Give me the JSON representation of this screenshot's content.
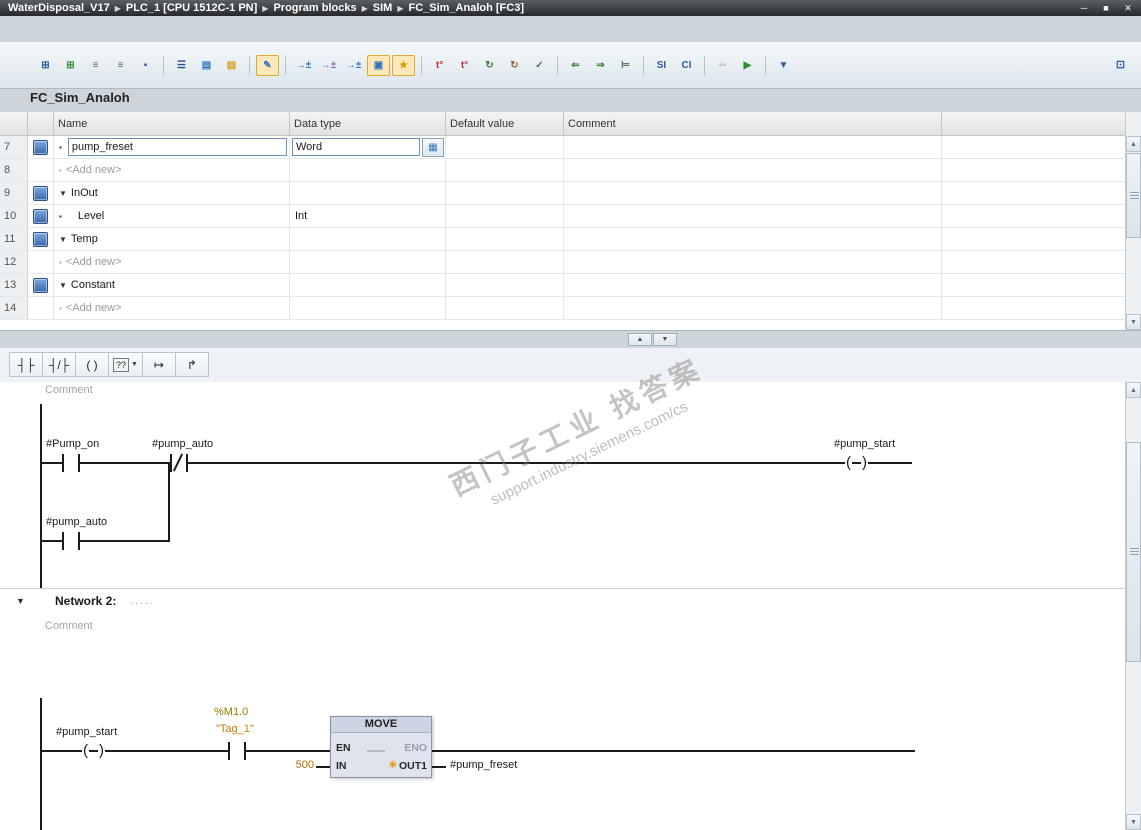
{
  "titlebar": {
    "breadcrumb": [
      "WaterDisposal_V17",
      "PLC_1 [CPU 1512C-1 PN]",
      "Program blocks",
      "SIM",
      "FC_Sim_Analoh [FC3]"
    ],
    "window_buttons": [
      {
        "name": "minimize-button",
        "glyph": "─"
      },
      {
        "name": "maximize-button",
        "glyph": "■"
      },
      {
        "name": "close-button",
        "glyph": "✕"
      }
    ]
  },
  "toolbar": {
    "icons": [
      {
        "name": "insert-row-icon",
        "glyph": "⊞",
        "color": "#2b5f9e"
      },
      {
        "name": "add-row-icon",
        "glyph": "⊞",
        "color": "#3a8a3a"
      },
      {
        "name": "reset-start-values-icon",
        "glyph": "≡",
        "color": "#5a6670"
      },
      {
        "name": "update-interface-icon",
        "glyph": "≡",
        "color": "#5a6670"
      },
      {
        "name": "keep-actual-values-icon",
        "glyph": "▪",
        "color": "#2b5f9e"
      },
      {
        "sep": true
      },
      {
        "name": "absolute-symbolic-operands-icon",
        "glyph": "☰",
        "color": "#1f4f8f"
      },
      {
        "name": "expand-all-networks-icon",
        "glyph": "▤",
        "color": "#2f74c0"
      },
      {
        "name": "collapse-all-networks-icon",
        "glyph": "▤",
        "color": "#d7a11e"
      },
      {
        "sep": true
      },
      {
        "name": "network-comments-icon",
        "glyph": "✎",
        "color": "#2f74c0",
        "active": true
      },
      {
        "sep": true
      },
      {
        "name": "insert-network-icon",
        "glyph": "→±",
        "color": "#2f74c0"
      },
      {
        "name": "insert-empty-box-icon",
        "glyph": "→±",
        "color": "#8a6ab8"
      },
      {
        "name": "open-all-branches-icon",
        "glyph": "→±",
        "color": "#2f74c0"
      },
      {
        "name": "lad-layout-toggle-icon",
        "glyph": "▣",
        "color": "#2f74c0",
        "active": true
      },
      {
        "name": "favorites-toggle-icon",
        "glyph": "★",
        "color": "#d79b00",
        "active": true
      },
      {
        "sep": true
      },
      {
        "name": "delete-timestamps-icon",
        "glyph": "t°",
        "color": "#c03030"
      },
      {
        "name": "update-block-calls-icon",
        "glyph": "t°",
        "color": "#c03030"
      },
      {
        "name": "sync-interface-icon",
        "glyph": "↻",
        "color": "#3a7a3a"
      },
      {
        "name": "consistency-check-icon",
        "glyph": "↻",
        "color": "#8a6a2a"
      },
      {
        "name": "compile-block-icon",
        "glyph": "✓",
        "color": "#3a7a3a"
      },
      {
        "sep": true
      },
      {
        "name": "goto-previous-error-icon",
        "glyph": "⇐",
        "color": "#3a7a3a"
      },
      {
        "name": "goto-next-error-icon",
        "glyph": "⇒",
        "color": "#3a7a3a"
      },
      {
        "name": "goto-definition-icon",
        "glyph": "⊨",
        "color": "#3a7a3a"
      },
      {
        "sep": true
      },
      {
        "name": "monitoring-toggle-icon",
        "glyph": "SI",
        "color": "#2b5f9e"
      },
      {
        "name": "call-environment-icon",
        "glyph": "CI",
        "color": "#2b5f9e"
      },
      {
        "sep": true
      },
      {
        "name": "breakpoints-icon",
        "glyph": "◦◦",
        "color": "#6a7680"
      },
      {
        "name": "start-simulation-icon",
        "glyph": "▶",
        "color": "#2f8f2f"
      },
      {
        "sep": true
      },
      {
        "name": "download-icon",
        "glyph": "▼",
        "color": "#2b5f9e"
      }
    ],
    "split_icon_glyph": "⊡"
  },
  "block": {
    "title": "FC_Sim_Analoh"
  },
  "interface_table": {
    "headers": {
      "name": "Name",
      "data_type": "Data type",
      "default_value": "Default value",
      "comment": "Comment"
    },
    "rows": [
      {
        "num": "7",
        "kind": "var",
        "name": "pump_freset",
        "data_type": "Word",
        "editing": true
      },
      {
        "num": "8",
        "kind": "add",
        "name": "<Add new>"
      },
      {
        "num": "9",
        "kind": "section",
        "name": "InOut"
      },
      {
        "num": "10",
        "kind": "var",
        "name": "Level",
        "data_type": "Int"
      },
      {
        "num": "11",
        "kind": "section",
        "name": "Temp"
      },
      {
        "num": "12",
        "kind": "add",
        "name": "<Add new>"
      },
      {
        "num": "13",
        "kind": "section",
        "name": "Constant"
      },
      {
        "num": "14",
        "kind": "add",
        "name": "<Add new>"
      }
    ]
  },
  "lad_toolbar": {
    "items": [
      {
        "name": "no-contact-icon",
        "glyph": "┤├"
      },
      {
        "name": "nc-contact-icon",
        "glyph": "┤/├"
      },
      {
        "name": "coil-icon",
        "glyph": "( )"
      },
      {
        "name": "empty-box-icon",
        "glyph": "??",
        "boxed": true,
        "dropdown": true
      },
      {
        "name": "open-branch-icon",
        "glyph": "↦"
      },
      {
        "name": "close-branch-icon",
        "glyph": "↱"
      }
    ]
  },
  "network1": {
    "comment": "Comment",
    "labels": {
      "contact1": "#Pump_on",
      "contact2": "#pump_auto",
      "branch_contact": "#pump_auto",
      "coil": "#pump_start"
    }
  },
  "network2": {
    "header": {
      "expander": "▼",
      "title": "Network 2:",
      "dots": "....."
    },
    "comment": "Comment",
    "labels": {
      "element1": "#pump_start",
      "address": "%M1.0",
      "tag": "\"Tag_1\""
    },
    "move": {
      "title": "MOVE",
      "en": "EN",
      "eno": "ENO",
      "in_pin": "IN",
      "out_pin": "OUT1",
      "in_value": "500",
      "out_target": "#pump_freset",
      "conversion_glyph": "✳"
    }
  },
  "watermark": {
    "line1": "西门子工业 找答案",
    "line2": "support.industry.siemens.com/cs"
  },
  "glyphs": {
    "bullet": "▪",
    "expander": "▼",
    "picker": "▦",
    "up": "▲",
    "down": "▼",
    "crumb_sep": "▶"
  },
  "colors": {
    "tag": "#c87e00",
    "address": "#9c7a00",
    "constant": "#b86a00",
    "active_tool_bg": "#fde9b8"
  }
}
